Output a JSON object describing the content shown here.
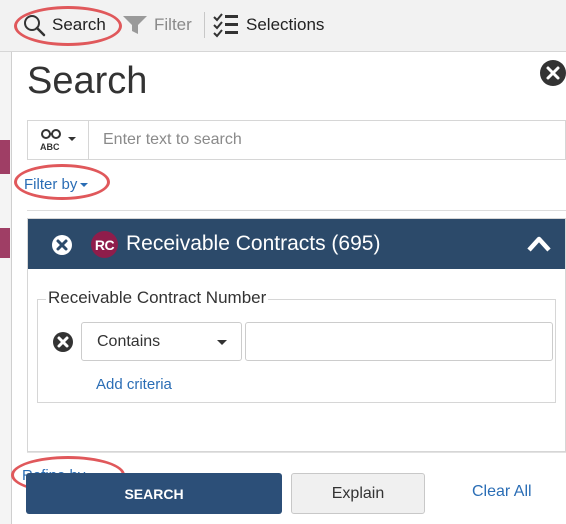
{
  "toolbar": {
    "search_label": "Search",
    "filter_label": "Filter",
    "selections_label": "Selections"
  },
  "panel": {
    "title": "Search",
    "search_placeholder": "Enter text to search",
    "filter_by_label": "Filter by",
    "group": {
      "badge": "RC",
      "title": "Receivable Contracts (695)",
      "field_label": "Receivable Contract Number",
      "operator": "Contains",
      "value": "",
      "add_criteria_label": "Add criteria"
    },
    "refine_by_label": "Refine by"
  },
  "footer": {
    "search_button": "SEARCH",
    "explain_button": "Explain",
    "clear_all_link": "Clear All"
  },
  "colors": {
    "header_bg": "#2c4a6a",
    "badge_bg": "#8f1d4b",
    "link": "#2a6db5",
    "highlight": "#e0585b",
    "primary_button": "#2c4f78"
  },
  "icons": [
    "magnifier-icon",
    "funnel-icon",
    "checklist-icon",
    "close-icon",
    "abc-search-mode-icon",
    "chevron-up-icon"
  ]
}
